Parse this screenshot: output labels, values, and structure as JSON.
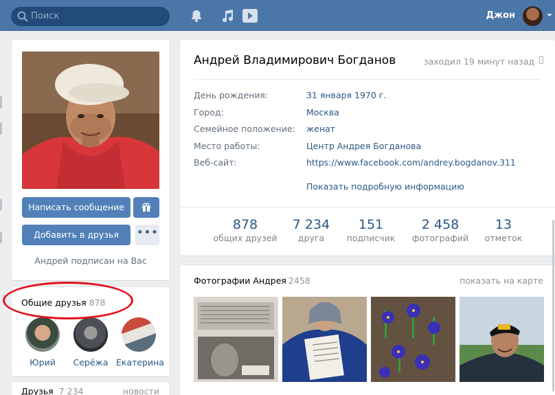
{
  "header": {
    "search_placeholder": "Поиск",
    "user_name": "Джон",
    "icons": [
      "search-icon",
      "bell-icon",
      "music-icon",
      "play-icon"
    ],
    "accent_color": "#4a76a8"
  },
  "profile_card": {
    "message_button": "Написать сообщение",
    "add_friend_button": "Добавить в друзья",
    "more_button": "•••",
    "subscribed_note": "Андрей подписан на Вас"
  },
  "mutual_friends": {
    "title": "Общие друзья",
    "count": "878",
    "items": [
      {
        "name": "Юрий"
      },
      {
        "name": "Серёжа"
      },
      {
        "name": "Екатерина"
      }
    ]
  },
  "friends": {
    "title": "Друзья",
    "count": "7 234",
    "link": "новости"
  },
  "info": {
    "full_name": "Андрей Владимирович Богданов",
    "last_seen": "заходил 19 минут назад",
    "rows": [
      {
        "label": "День рождения:",
        "value": "31 января 1970 г."
      },
      {
        "label": "Город:",
        "value": "Москва"
      },
      {
        "label": "Семейное положение:",
        "value": "женат"
      },
      {
        "label": "Место работы:",
        "value": "Центр Андрея Богданова"
      },
      {
        "label": "Веб-сайт:",
        "value": "https://www.facebook.com/andrey.bogdanov.311"
      }
    ],
    "show_more": "Показать подробную информацию",
    "counters": [
      {
        "num": "878",
        "label": "общих друзей"
      },
      {
        "num": "7 234",
        "label": "друга"
      },
      {
        "num": "151",
        "label": "подписчик"
      },
      {
        "num": "2 458",
        "label": "фотографий"
      },
      {
        "num": "13",
        "label": "отметок"
      }
    ]
  },
  "photos": {
    "title": "Фотографии Андрея",
    "count": "2458",
    "map_link": "показать на карте"
  }
}
